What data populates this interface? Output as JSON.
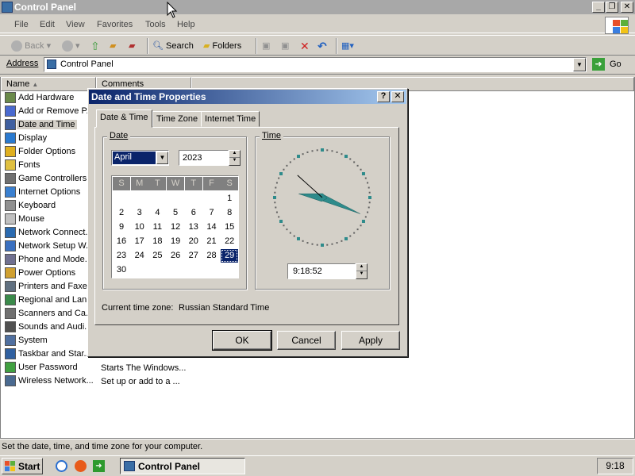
{
  "window": {
    "title": "Control Panel",
    "buttons": [
      "_",
      "❐",
      "✕"
    ]
  },
  "menubar": [
    "File",
    "Edit",
    "View",
    "Favorites",
    "Tools",
    "Help"
  ],
  "toolbar": {
    "back": "Back",
    "search": "Search",
    "folders": "Folders"
  },
  "address": {
    "label": "Address",
    "value": "Control Panel",
    "go": "Go"
  },
  "list": {
    "columns": [
      "Name",
      "Comments"
    ],
    "items": [
      "Add Hardware",
      "Add or Remove P...",
      "Date and Time",
      "Display",
      "Folder Options",
      "Fonts",
      "Game Controllers",
      "Internet Options",
      "Keyboard",
      "Mouse",
      "Network Connect...",
      "Network Setup W...",
      "Phone and Mode...",
      "Power Options",
      "Printers and Faxes",
      "Regional and Lan...",
      "Scanners and Ca...",
      "Sounds and Audi...",
      "System",
      "Taskbar and Star...",
      "User Password",
      "Wireless Network..."
    ],
    "visible_comments": [
      "Starts The Windows...",
      "Set up or add to a ..."
    ]
  },
  "statusbar": "Set the date, time, and time zone for your computer.",
  "taskbar": {
    "start": "Start",
    "task": "Control Panel",
    "clock": "9:18"
  },
  "dialog": {
    "title": "Date and Time Properties",
    "title_buttons": [
      "?",
      "✕"
    ],
    "tabs": [
      "Date & Time",
      "Time Zone",
      "Internet Time"
    ],
    "date_group": "Date",
    "month": "April",
    "year": "2023",
    "weekdays": [
      "S",
      "M",
      "T",
      "W",
      "T",
      "F",
      "S"
    ],
    "days": [
      "1",
      "2",
      "3",
      "4",
      "5",
      "6",
      "7",
      "8",
      "9",
      "10",
      "11",
      "12",
      "13",
      "14",
      "15",
      "16",
      "17",
      "18",
      "19",
      "20",
      "21",
      "22",
      "23",
      "24",
      "25",
      "26",
      "27",
      "28",
      "29",
      "30"
    ],
    "first_weekday_index": 6,
    "selected_day": "29",
    "time_group": "Time",
    "time": "9:18:52",
    "clock": {
      "hour": 9,
      "minute": 18,
      "second": 52
    },
    "timezone_label": "Current time zone:",
    "timezone_value": "Russian Standard Time",
    "buttons": [
      "OK",
      "Cancel",
      "Apply"
    ]
  },
  "colors": {
    "active_title": "#0a246a",
    "inactive_title": "#a8a8a8",
    "clock_hands": "#2e8b8b"
  }
}
